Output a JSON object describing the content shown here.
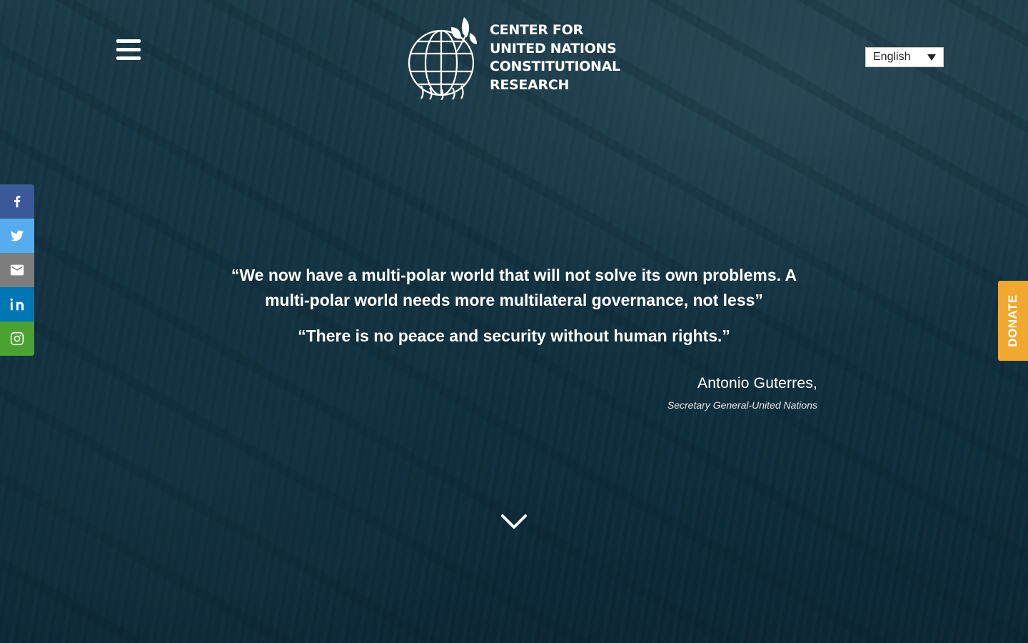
{
  "header": {
    "logo_lines": [
      "CENTER FOR",
      "UNITED NATIONS",
      "CONSTITUTIONAL",
      "RESEARCH"
    ],
    "language": {
      "selected": "English"
    }
  },
  "share_bar": [
    {
      "icon": "facebook-icon"
    },
    {
      "icon": "twitter-icon"
    },
    {
      "icon": "email-icon"
    },
    {
      "icon": "linkedin-icon"
    },
    {
      "icon": "instagram-icon"
    }
  ],
  "donate": {
    "label": "DONATE",
    "color": "#f0a830"
  },
  "hero": {
    "quote1": "“We now have a multi-polar world that will not solve its own problems. A multi-polar world needs more multilateral governance, not less”",
    "quote2": "“There is no peace and security without human rights.”",
    "author_name": "Antonio Guterres,",
    "author_title": "Secretary General-United Nations"
  },
  "colors": {
    "facebook": "#3b5998",
    "twitter": "#55acee",
    "email": "#7d7d7d",
    "linkedin": "#0077b5",
    "instagram": "#4ba131",
    "overlay": "#10303f"
  }
}
